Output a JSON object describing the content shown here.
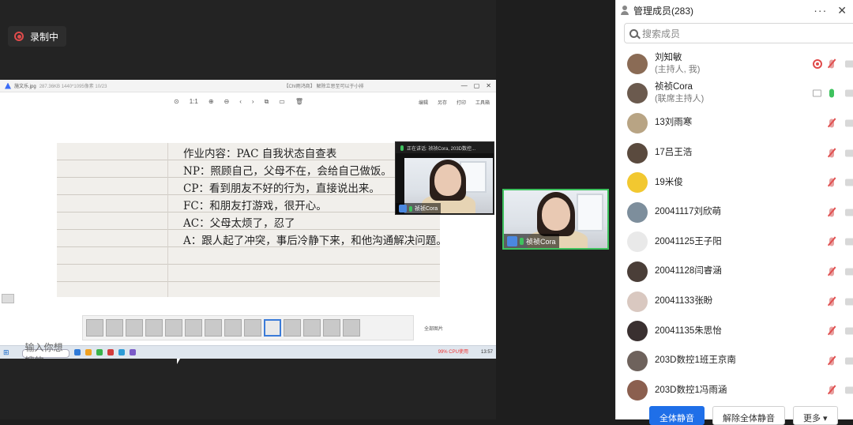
{
  "recording": {
    "label": "录制中"
  },
  "viewer": {
    "filename": "施文乐.jpg",
    "info": "287.36KB  1440*1095像素  10/23",
    "center_info": "【ChI雨鸿商】 解除立思至可以于小排",
    "tools": [
      "⊙",
      "1:1",
      "⊕",
      "⊖",
      "‹",
      "›",
      "⧉",
      "▭",
      "🗑"
    ],
    "right_tools": [
      "编辑",
      "另存",
      "打印",
      "工具箱"
    ],
    "win_controls": [
      "—",
      "▢",
      "✕"
    ]
  },
  "note_lines": [
    "作业内容：PAC 自我状态自查表",
    "NP：照顾自己，父母不在，会给自己做饭。",
    "CP：看到朋友不好的行为，直接说出来。",
    "FC：和朋友打游戏，很开心。",
    "AC：父母太烦了，忍了",
    "A：跟人起了冲突，事后冷静下来，和他沟通解决问题。"
  ],
  "thumb_strip": {
    "all_label": "全部图片",
    "count": 14,
    "selected_index": 9
  },
  "taskbar": {
    "search_placeholder": "输入你想搜的",
    "cpu": "99%\nCPU使用",
    "time": "13:57"
  },
  "small_tile": {
    "caption": "正在讲话: 祯祯Cora, 203D数控...",
    "label": "祯祯Cora"
  },
  "big_tile": {
    "label": "祯祯Cora"
  },
  "panel": {
    "title": "管理成员(283)",
    "more": "···",
    "close": "✕",
    "search_placeholder": "搜索成员",
    "members": [
      {
        "name": "刘知敏",
        "sub": "(主持人, 我)",
        "rec": true,
        "mic": "muted",
        "screen": false,
        "avatar_color": "#8a6b55"
      },
      {
        "name": "祯祯Cora",
        "sub": "(联席主持人)",
        "rec": false,
        "mic": "on",
        "screen": true,
        "avatar_color": "#6b5a4e"
      },
      {
        "name": "13刘雨寒",
        "sub": "",
        "rec": false,
        "mic": "muted",
        "screen": false,
        "avatar_color": "#b8a484"
      },
      {
        "name": "17吕王浩",
        "sub": "",
        "rec": false,
        "mic": "muted",
        "screen": false,
        "avatar_color": "#5a4a3e"
      },
      {
        "name": "19米俊",
        "sub": "",
        "rec": false,
        "mic": "muted",
        "screen": false,
        "avatar_color": "#f2c830"
      },
      {
        "name": "20041117刘欣萌",
        "sub": "",
        "rec": false,
        "mic": "muted",
        "screen": false,
        "avatar_color": "#7d8e9c"
      },
      {
        "name": "20041125王子阳",
        "sub": "",
        "rec": false,
        "mic": "muted",
        "screen": false,
        "avatar_color": "#e9e9e9"
      },
      {
        "name": "20041128闫睿涵",
        "sub": "",
        "rec": false,
        "mic": "muted",
        "screen": false,
        "avatar_color": "#4a3e38"
      },
      {
        "name": "20041133张盼",
        "sub": "",
        "rec": false,
        "mic": "muted",
        "screen": false,
        "avatar_color": "#d9c8c0"
      },
      {
        "name": "20041135朱思怡",
        "sub": "",
        "rec": false,
        "mic": "muted",
        "screen": false,
        "avatar_color": "#3a3030"
      },
      {
        "name": "203D数控1班王京南",
        "sub": "",
        "rec": false,
        "mic": "muted",
        "screen": false,
        "avatar_color": "#6e625c"
      },
      {
        "name": "203D数控1冯雨涵",
        "sub": "",
        "rec": false,
        "mic": "muted",
        "screen": false,
        "avatar_color": "#8b5f4f"
      }
    ],
    "footer": {
      "mute_all": "全体静音",
      "unmute_all": "解除全体静音",
      "more": "更多 ▾"
    }
  }
}
